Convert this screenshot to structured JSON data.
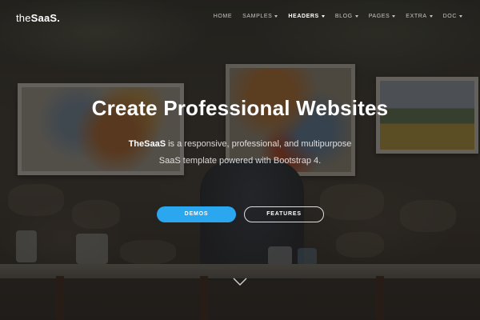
{
  "brand": {
    "prefix": "the",
    "name": "SaaS."
  },
  "nav": {
    "items": [
      {
        "label": "HOME",
        "dropdown": false,
        "active": false
      },
      {
        "label": "SAMPLES",
        "dropdown": true,
        "active": false
      },
      {
        "label": "HEADERS",
        "dropdown": true,
        "active": true
      },
      {
        "label": "BLOG",
        "dropdown": true,
        "active": false
      },
      {
        "label": "PAGES",
        "dropdown": true,
        "active": false
      },
      {
        "label": "EXTRA",
        "dropdown": true,
        "active": false
      },
      {
        "label": "DOC",
        "dropdown": true,
        "active": false
      }
    ]
  },
  "hero": {
    "title": "Create Professional Websites",
    "lead_brand": "TheSaaS",
    "lead_line1": " is a responsive, professional, and multipurpose",
    "lead_line2": "SaaS template powered with Bootstrap 4.",
    "primary_button": "DEMOS",
    "secondary_button": "FEATURES"
  },
  "colors": {
    "accent": "#2ba7ef",
    "text": "#ffffff"
  },
  "icons": {
    "scroll": "chevron-down-icon"
  }
}
